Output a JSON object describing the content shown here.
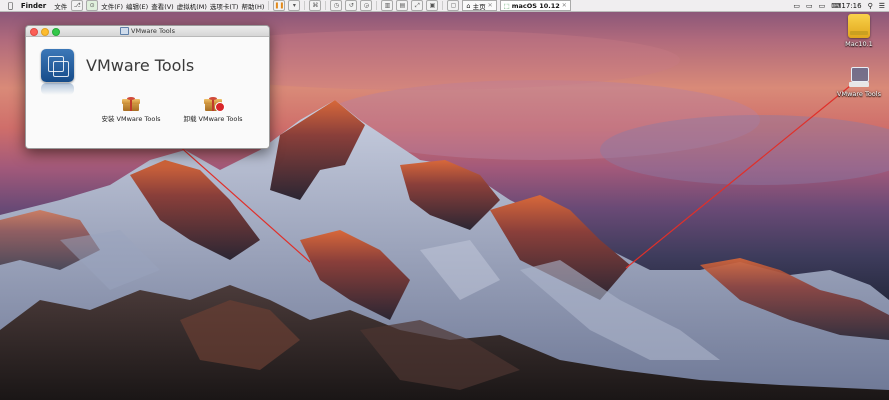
{
  "menubar": {
    "apple": "",
    "app_name": "Finder",
    "file_menu": "文件",
    "vm_menus": [
      "文件(F)",
      "编辑(E)",
      "查看(V)",
      "虚拟机(M)",
      "选项卡(T)",
      "帮助(H)"
    ],
    "tabs": [
      {
        "label": "主页",
        "active": false
      },
      {
        "label": "macOS 10.12",
        "active": true
      }
    ],
    "clock": "17:16"
  },
  "window": {
    "title": "VMware Tools",
    "product_title": "VMware Tools",
    "install_label": "安装 VMware Tools",
    "uninstall_label": "卸载 VMware Tools"
  },
  "desktop": {
    "disk_label": "Mac10.1",
    "vmtools_label": "VMware Tools"
  },
  "colors": {
    "annotation_line": "#e0302a",
    "close": "#fc5f57",
    "minimize": "#fdbc2e",
    "zoom": "#34c84a"
  }
}
